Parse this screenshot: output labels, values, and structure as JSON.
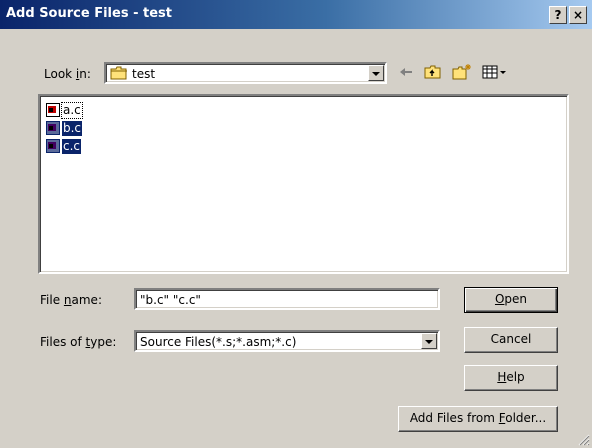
{
  "window": {
    "title": "Add Source Files - test",
    "help_glyph": "?",
    "close_glyph": "×"
  },
  "look_in": {
    "label_prefix": "Look ",
    "label_accel": "i",
    "label_suffix": "n:",
    "value": "test",
    "value_icon": "folder-icon"
  },
  "toolbar": {
    "items": [
      {
        "name": "back-arrow-icon"
      },
      {
        "name": "up-folder-icon"
      },
      {
        "name": "new-folder-icon"
      },
      {
        "name": "view-menu-icon"
      }
    ]
  },
  "files": [
    {
      "name": "a.c",
      "selected": false,
      "focused": true
    },
    {
      "name": "b.c",
      "selected": true,
      "focused": false
    },
    {
      "name": "c.c",
      "selected": true,
      "focused": false
    }
  ],
  "file_name": {
    "label_prefix": "File ",
    "label_accel": "n",
    "label_suffix": "ame:",
    "value": "\"b.c\" \"c.c\""
  },
  "file_type": {
    "label_prefix": "Files of ",
    "label_accel": "t",
    "label_suffix": "ype:",
    "value": "Source Files(*.s;*.asm;*.c)"
  },
  "buttons": {
    "open": {
      "accel": "O",
      "rest": "pen"
    },
    "cancel": {
      "label": "Cancel"
    },
    "help": {
      "accel": "H",
      "rest": "elp"
    },
    "add_folder": {
      "prefix": "Add Files from ",
      "accel": "F",
      "rest": "older..."
    }
  },
  "colors": {
    "dialog_bg": "#d4d0c8",
    "title_bar_start": "#0a246a",
    "title_bar_end": "#a6caf0",
    "selection": "#0a246a"
  }
}
